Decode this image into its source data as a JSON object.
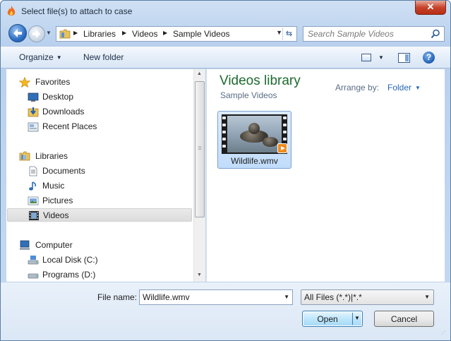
{
  "window": {
    "title": "Select file(s) to attach to case",
    "close_label": "✕"
  },
  "address_bar": {
    "crumbs": [
      "Libraries",
      "Videos",
      "Sample Videos"
    ]
  },
  "search": {
    "placeholder": "Search Sample Videos"
  },
  "toolbar": {
    "organize_label": "Organize",
    "new_folder_label": "New folder",
    "help_label": "?"
  },
  "nav_pane": {
    "favorites_label": "Favorites",
    "favorites": [
      "Desktop",
      "Downloads",
      "Recent Places"
    ],
    "libraries_label": "Libraries",
    "libraries": [
      "Documents",
      "Music",
      "Pictures",
      "Videos"
    ],
    "computer_label": "Computer",
    "computer": [
      "Local Disk (C:)",
      "Programs (D:)"
    ],
    "selected": "Videos"
  },
  "content": {
    "library_title": "Videos library",
    "library_subtitle": "Sample Videos",
    "arrange_label": "Arrange by:",
    "arrange_value": "Folder",
    "files": [
      {
        "name": "Wildlife.wmv",
        "selected": true
      }
    ]
  },
  "bottom": {
    "file_name_label": "File name:",
    "file_name_value": "Wildlife.wmv",
    "file_type_value": "All Files (*.*)|*.*",
    "open_label": "Open",
    "cancel_label": "Cancel"
  },
  "colors": {
    "library_title": "#1e6b2f",
    "arrange_value": "#2766b7",
    "close_button": "#c7432c",
    "selection": "#c1dcfb"
  }
}
